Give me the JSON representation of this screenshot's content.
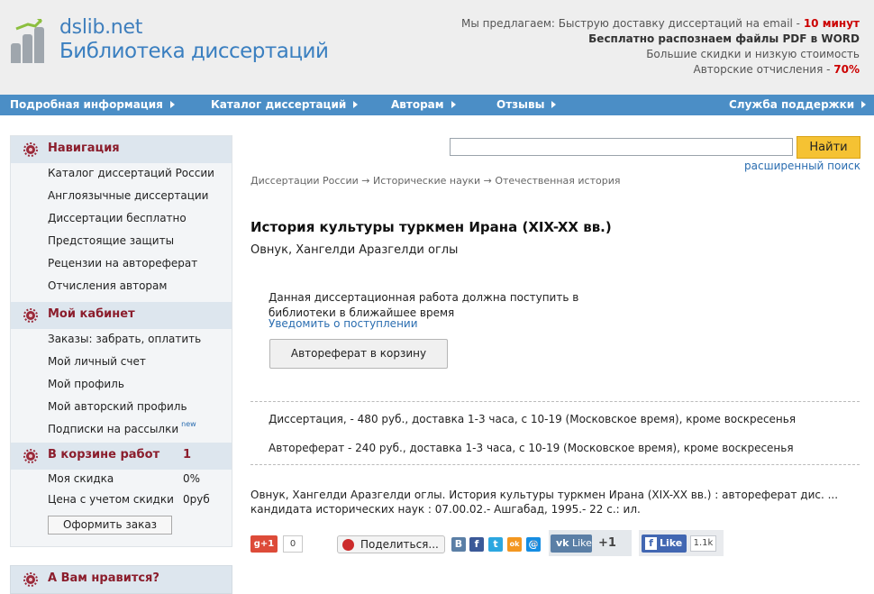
{
  "header": {
    "logo_domain": "dslib.net",
    "logo_title": "Библиотека диссертаций",
    "promo_line1_text": "Мы предлагаем: Быструю доставку диссертаций на email - ",
    "promo_line1_highlight": "10 минут",
    "promo_line2": "Бесплатно распознаем файлы PDF в WORD",
    "promo_line3": "Большие скидки и низкую стоимость",
    "promo_line4_text": "Авторские отчисления - ",
    "promo_line4_highlight": "70%"
  },
  "nav": {
    "items": [
      {
        "label": "Подробная информация"
      },
      {
        "label": "Каталог диссертаций"
      },
      {
        "label": "Авторам"
      },
      {
        "label": "Отзывы"
      },
      {
        "label": "Служба поддержки"
      }
    ]
  },
  "sidebar": {
    "navigation": {
      "title": "Навигация",
      "links": [
        "Каталог диссертаций России",
        "Англоязычные диссертации",
        "Диссертации бесплатно",
        "Предстоящие защиты",
        "Рецензии на автореферат",
        "Отчисления авторам"
      ]
    },
    "cabinet": {
      "title": "Мой кабинет",
      "links": [
        "Заказы: забрать, оплатить",
        "Мой личный счет",
        "Мой профиль",
        "Мой авторский профиль",
        "Подписки на рассылки"
      ],
      "new_badge": "new"
    },
    "cart": {
      "title": "В корзине работ",
      "count": "1",
      "discount_label": "Моя скидка",
      "discount_value": "0%",
      "price_label": "Цена с учетом скидки",
      "price_value": "0руб",
      "order_button": "Оформить заказ"
    },
    "poll": {
      "title": "А Вам нравится?"
    }
  },
  "search": {
    "value": "",
    "button": "Найти",
    "advanced": "расширенный поиск"
  },
  "breadcrumb": "Диссертации России → Исторические науки → Отечественная история",
  "dissertation": {
    "title": "История культуры туркмен Ирана (XIX-XX вв.)",
    "author": "Овнук, Хангелди Аразгелди оглы",
    "notice": "Данная диссертационная работа должна поступить в библиотеки в ближайшее время",
    "notify_link": "Уведомить о поступлении",
    "cart_button": "Автореферат в корзину",
    "price_dissertation": "Диссертация, - 480 руб., доставка 1-3 часа, с 10-19 (Московское время), кроме воскресенья",
    "price_abstract": "Автореферат - 240 руб., доставка 1-3 часа, с 10-19 (Московское время), кроме воскресенья",
    "citation": "Овнук, Хангелди Аразгелди оглы. История культуры туркмен Ирана (XIX-XX вв.) : автореферат дис. ... кандидата исторических наук : 07.00.02.- Ашгабад, 1995.- 22 с.: ил."
  },
  "social": {
    "gplus_label": "g+1",
    "gplus_count": "0",
    "share_label": "Поделиться...",
    "icons": [
      {
        "name": "vk-icon",
        "glyph": "B",
        "color": "#5b7fa6"
      },
      {
        "name": "facebook-icon",
        "glyph": "f",
        "color": "#3b5998"
      },
      {
        "name": "twitter-icon",
        "glyph": "t",
        "color": "#2ca7e0"
      },
      {
        "name": "odnoklassniki-icon",
        "glyph": "ok",
        "color": "#f39720"
      },
      {
        "name": "moimir-icon",
        "glyph": "@",
        "color": "#168de2"
      },
      {
        "name": "bookmark-icon",
        "glyph": "✎",
        "color": "#6d8bb0"
      }
    ],
    "vk_like": "Like",
    "vk_count": "+1",
    "fb_like": "Like",
    "fb_count": "1.1k"
  }
}
